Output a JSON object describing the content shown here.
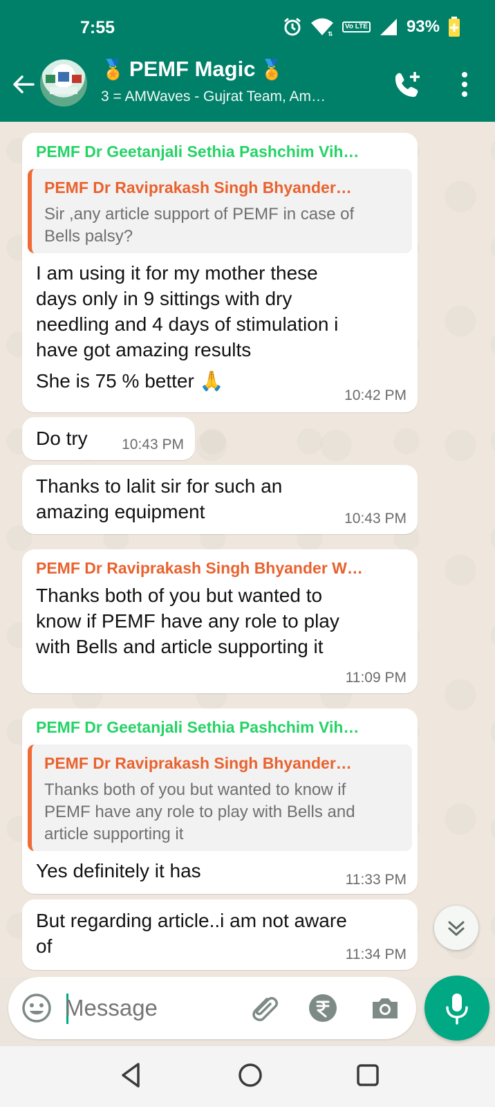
{
  "status_bar": {
    "time": "7:55",
    "lte_label": "Vo LTE",
    "battery": "93%"
  },
  "header": {
    "title": "PEMF Magic",
    "title_prefix_icon": "medal-icon",
    "title_suffix_icon": "medal-icon",
    "subtitle": "3 = AMWaves - Gujrat Team, Am…",
    "accent_color": "#008069"
  },
  "messages": [
    {
      "sender": "PEMF Dr Geetanjali Sethia Pashchim Vih…",
      "sender_color": "#25d366",
      "quote": {
        "sender": "PEMF Dr Raviprakash Singh Bhyander…",
        "text_lines": [
          "Sir ,any article support of PEMF in case of",
          "Bells palsy?"
        ]
      },
      "text_lines": [
        "I am using it for my mother these",
        "days only in 9 sittings with dry",
        "needling and 4 days of stimulation i",
        "have got amazing results",
        "She is 75 % better 🙏"
      ],
      "time": "10:42 PM"
    },
    {
      "text_lines": [
        "Do try"
      ],
      "time": "10:43 PM"
    },
    {
      "text_lines": [
        "Thanks to lalit sir for such an",
        "amazing equipment"
      ],
      "time": "10:43 PM"
    },
    {
      "sender": "PEMF Dr Raviprakash Singh Bhyander W…",
      "sender_color": "#e9622e",
      "text_lines": [
        "Thanks both of you  but wanted to",
        "know if PEMF have any role to play",
        "with Bells and article supporting it"
      ],
      "time": "11:09 PM"
    },
    {
      "sender": "PEMF Dr Geetanjali Sethia Pashchim Vih…",
      "sender_color": "#25d366",
      "quote": {
        "sender": "PEMF Dr Raviprakash Singh Bhyander…",
        "text_lines": [
          "Thanks both of you  but wanted to know if",
          "PEMF have any role to play with Bells and",
          "article supporting it"
        ]
      },
      "text_lines": [
        "Yes definitely it has"
      ],
      "time": "11:33 PM"
    },
    {
      "text_lines": [
        "But regarding article..i am not aware",
        "of"
      ],
      "time": "11:34 PM"
    }
  ],
  "composer": {
    "placeholder": "Message"
  }
}
